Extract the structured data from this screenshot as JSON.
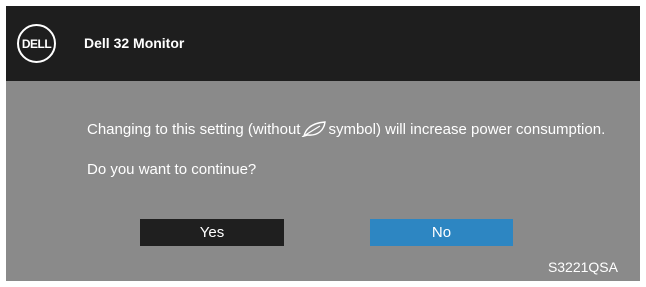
{
  "header": {
    "logo_text": "DELL",
    "title": "Dell 32 Monitor"
  },
  "dialog": {
    "message_before_icon": "Changing to this setting (without",
    "icon": "eco-leaf-icon",
    "message_after_icon": "symbol) will increase power consumption.",
    "question": "Do you want to continue?",
    "yes_label": "Yes",
    "no_label": "No",
    "selected": "No"
  },
  "footer": {
    "model": "S3221QSA"
  },
  "colors": {
    "header_bg": "#1e1e1e",
    "body_bg": "#8a8a8a",
    "yes_button_bg": "#1f1f1f",
    "selected_button_bg": "#2d86c2",
    "text": "#ffffff"
  }
}
